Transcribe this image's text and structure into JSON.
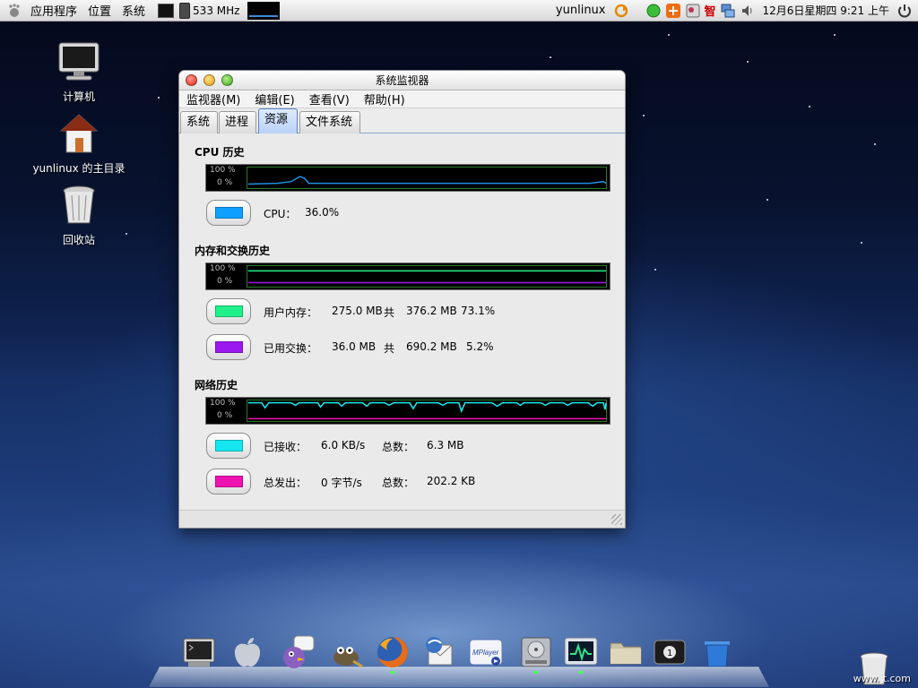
{
  "top_panel": {
    "applications": "应用程序",
    "places": "位置",
    "system": "系统",
    "cpu_freq": "533 MHz",
    "username": "yunlinux",
    "tray_ime": "智",
    "datetime": "12月6日星期四  9:21 上午"
  },
  "desktop": {
    "icons": [
      {
        "label": "计算机"
      },
      {
        "label": "yunlinux 的主目录"
      },
      {
        "label": "回收站"
      }
    ]
  },
  "window": {
    "title": "系统监视器",
    "menu": [
      "监视器(M)",
      "编辑(E)",
      "查看(V)",
      "帮助(H)"
    ],
    "tabs": [
      "系统",
      "进程",
      "资源",
      "文件系统"
    ],
    "active_tab": "资源",
    "cpu": {
      "title": "CPU 历史",
      "axis_top": "100 %",
      "axis_bottom": "0 %",
      "label": "CPU：",
      "value": "36.0%",
      "color": "#0f9fff"
    },
    "memory": {
      "title": "内存和交换历史",
      "axis_top": "100 %",
      "axis_bottom": "0 %",
      "user_mem_label": "用户内存：",
      "user_mem_used": "275.0 MB",
      "user_mem_of": "共",
      "user_mem_total": "376.2 MB",
      "user_mem_percent": "73.1%",
      "user_mem_color": "#1ff08a",
      "swap_label": "已用交换：",
      "swap_used": "36.0 MB",
      "swap_of": "共",
      "swap_total": "690.2 MB",
      "swap_percent": "5.2%",
      "swap_color": "#9b18f0"
    },
    "network": {
      "title": "网络历史",
      "axis_top": "100 %",
      "axis_bottom": "0 %",
      "received_label": "已接收：",
      "received_rate": "6.0 KB/s",
      "received_total_label": "总数：",
      "received_total": "6.3 MB",
      "received_color": "#14e7ef",
      "sent_label": "总发出：",
      "sent_rate": "0 字节/s",
      "sent_total_label": "总数：",
      "sent_total": "202.2 KB",
      "sent_color": "#ee12b0"
    }
  },
  "dock": {
    "items": [
      "terminal-icon",
      "apple-icon",
      "pidgin-icon",
      "gimp-icon",
      "firefox-icon",
      "thunderbird-icon",
      "mplayer-icon",
      "harddisk-icon",
      "system-monitor-icon",
      "folder-icon",
      "workspace-icon",
      "trash-icon"
    ],
    "workspace_number": "1"
  },
  "watermark": "www.      t.com"
}
